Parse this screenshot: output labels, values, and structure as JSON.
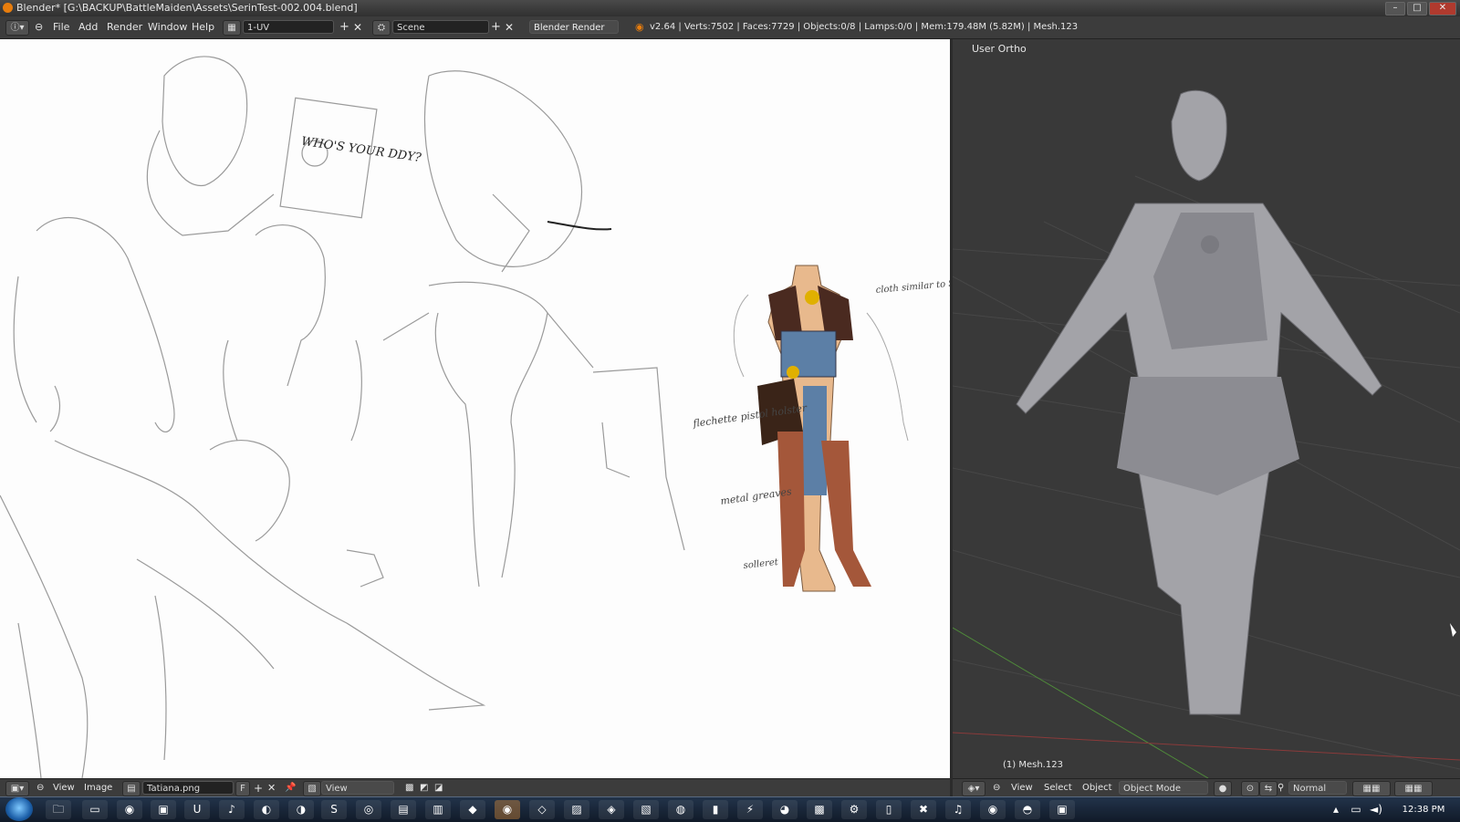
{
  "window": {
    "title": "Blender* [G:\\BACKUP\\BattleMaiden\\Assets\\SerinTest-002.004.blend]"
  },
  "header": {
    "menu": [
      "File",
      "Add",
      "Render",
      "Window",
      "Help"
    ],
    "layout_field": "1-UV",
    "scene_field": "Scene",
    "render_engine": "Blender Render",
    "stats": "v2.64 | Verts:7502 | Faces:7729 | Objects:0/8 | Lamps:0/0 | Mem:179.48M (5.82M) | Mesh.123"
  },
  "image_editor": {
    "sketch_notes": [
      "WHO'S YOUR DDY?",
      "cloth similar to Shinto shrine maidens (transparent)",
      "flechette pistol holster",
      "metal greaves",
      "solleret"
    ],
    "footer": {
      "menu": [
        "View",
        "Image"
      ],
      "image_name": "Tatiana.png",
      "fake_user": "F",
      "view_mode": "View"
    }
  },
  "viewport": {
    "label": "User Ortho",
    "object_label": "(1) Mesh.123",
    "footer": {
      "menu": [
        "View",
        "Select",
        "Object"
      ],
      "mode": "Object Mode",
      "orientation": "Normal"
    }
  },
  "taskbar": {
    "clock": "12:38 PM"
  },
  "colors": {
    "blender_orange": "#e87d0d",
    "header_bg": "#3c3c3c",
    "viewport_bg": "#393939"
  }
}
